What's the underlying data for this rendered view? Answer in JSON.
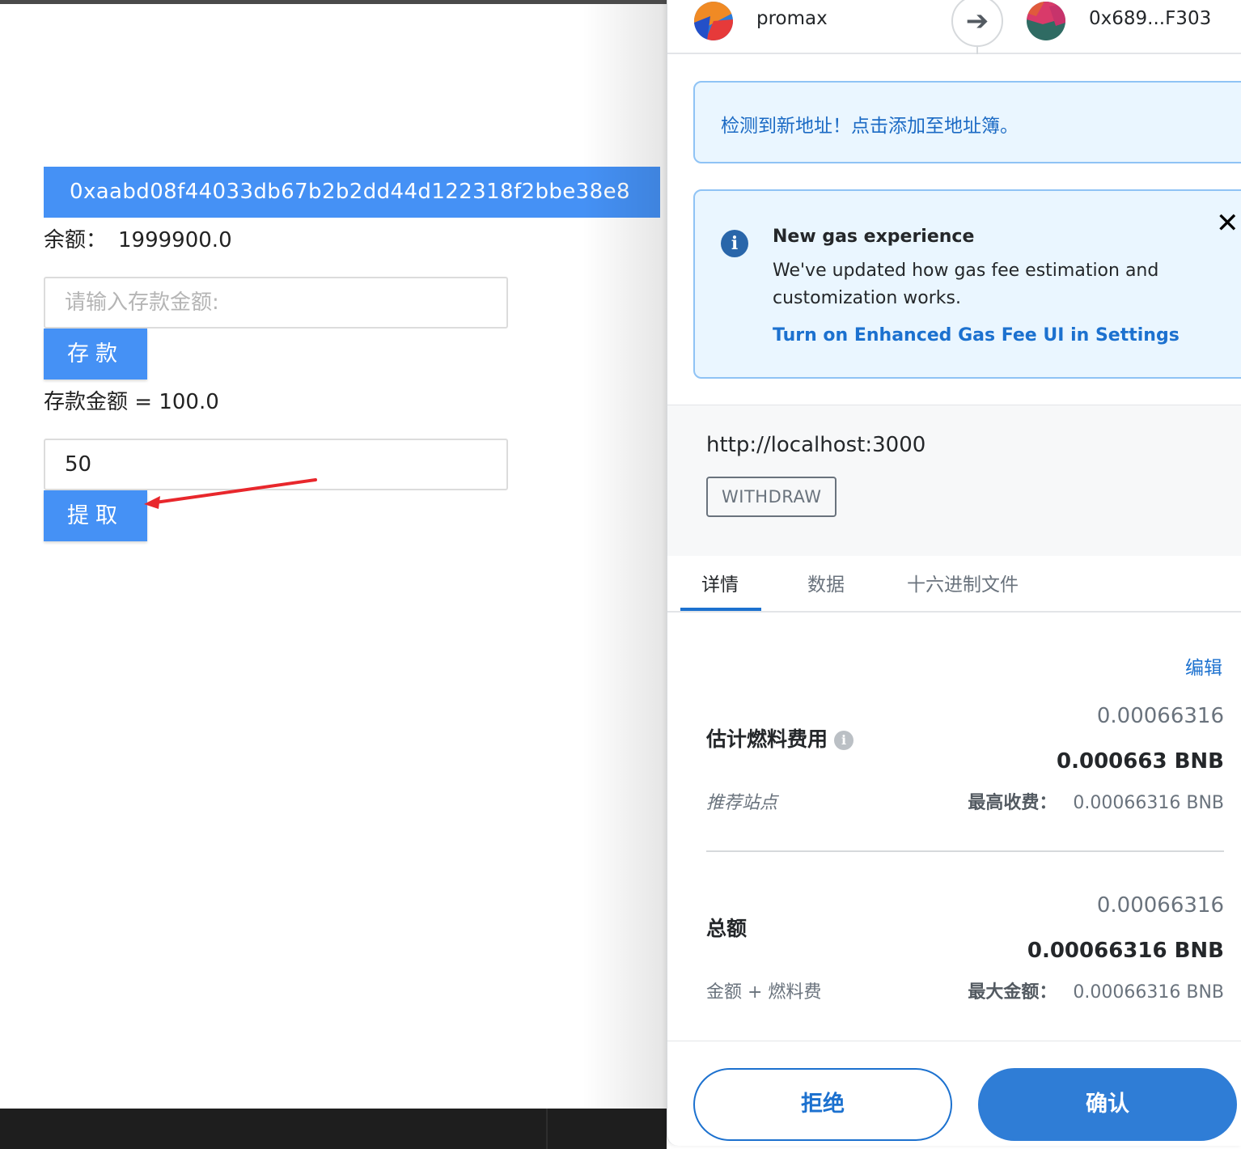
{
  "dapp": {
    "contract_address": "0xaabd08f44033db67b2b2dd44d122318f2bbe38e8",
    "balance_label": "余额：",
    "balance_value": "1999900.0",
    "deposit_input_placeholder": "请输入存款金额:",
    "deposit_button": "存款",
    "deposit_amount_text": "存款金额 = 100.0",
    "withdraw_input_value": "50",
    "withdraw_button": "提取",
    "annotation_arrow_color": "#e8272c"
  },
  "metamask": {
    "header": {
      "from_account": "promax",
      "to_address": "0x689...F303"
    },
    "new_address_alert": "检测到新地址！点击添加至地址簿。",
    "gas_notice": {
      "title": "New gas experience",
      "body": "We've updated how gas fee estimation and customization works.",
      "link": "Turn on Enhanced Gas Fee UI in Settings",
      "close": "✕"
    },
    "origin": "http://localhost:3000",
    "method": "WITHDRAW",
    "tabs": [
      {
        "label": "详情",
        "active": true
      },
      {
        "label": "数据",
        "active": false
      },
      {
        "label": "十六进制文件",
        "active": false
      }
    ],
    "edit_link": "编辑",
    "gas_fee": {
      "label": "估计燃料费用",
      "value_secondary": "0.00066316",
      "value_primary": "0.000663 BNB",
      "sub_left": "推荐站点",
      "max_label": "最高收费：",
      "max_value": "0.00066316 BNB"
    },
    "total": {
      "label": "总额",
      "value_secondary": "0.00066316",
      "value_primary": "0.00066316 BNB",
      "sub_left": "金额 + 燃料费",
      "max_label": "最大金额：",
      "max_value": "0.00066316 BNB"
    },
    "buttons": {
      "reject": "拒绝",
      "confirm": "确认"
    },
    "colors": {
      "primary_blue": "#1c71cf",
      "alert_bg": "#eaf6ff",
      "dapp_blue": "#4591f5"
    }
  }
}
